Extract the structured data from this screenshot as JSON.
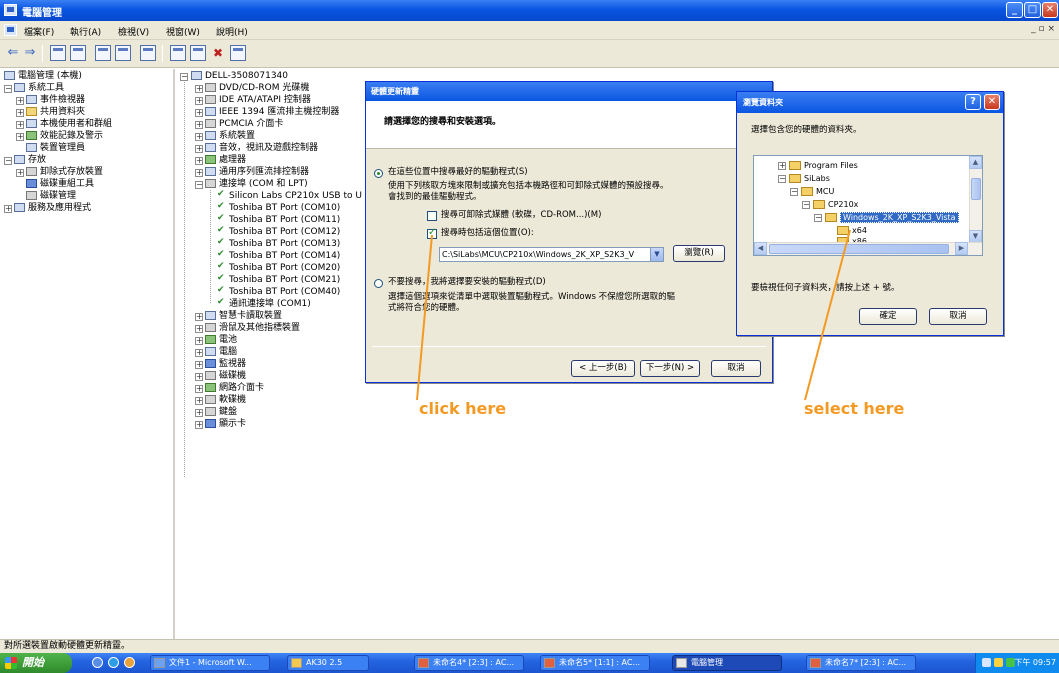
{
  "window": {
    "title": "電腦管理",
    "minimize_label": "_",
    "maximize_label": "□",
    "close_label": "✕"
  },
  "menu": {
    "items": [
      "檔案(F)",
      "執行(A)",
      "檢視(V)",
      "視窗(W)",
      "說明(H)"
    ],
    "mdi_controls": "_ ▫ ×"
  },
  "left_tree": {
    "root": "電腦管理 (本機)",
    "system_tools": "系統工具",
    "event_viewer": "事件檢視器",
    "shared_folders": "共用資料夾",
    "local_users": "本機使用者和群組",
    "perf_logs": "效能記錄及警示",
    "device_manager": "裝置管理員",
    "storage": "存放",
    "removable_storage": "卸除式存放裝置",
    "defrag": "磁碟重組工具",
    "disk_mgmt": "磁碟管理",
    "services": "服務及應用程式"
  },
  "device_tree": {
    "root": "DELL-3508071340",
    "dvd": "DVD/CD-ROM 光碟機",
    "ide": "IDE ATA/ATAPI 控制器",
    "ieee": "IEEE 1394 匯流排主機控制器",
    "pcmcia": "PCMCIA 介面卡",
    "system": "系統裝置",
    "sound": "音效，視訊及遊戲控制器",
    "processor": "處理器",
    "usb": "通用序列匯流排控制器",
    "ports": "連接埠 (COM 和 LPT)",
    "port_items": [
      "Silicon Labs CP210x USB to U",
      "Toshiba BT Port (COM10)",
      "Toshiba BT Port (COM11)",
      "Toshiba BT Port (COM12)",
      "Toshiba BT Port (COM13)",
      "Toshiba BT Port (COM14)",
      "Toshiba BT Port (COM20)",
      "Toshiba BT Port (COM21)",
      "Toshiba BT Port (COM40)",
      "通訊連接埠 (COM1)"
    ],
    "smartcard": "智慧卡讀取裝置",
    "mouse": "滑鼠及其他指標裝置",
    "battery": "電池",
    "computer": "電腦",
    "monitor": "監視器",
    "disk": "磁碟機",
    "network": "網路介面卡",
    "floppy": "軟碟機",
    "keyboard": "鍵盤",
    "display": "顯示卡"
  },
  "wizard": {
    "title": "硬體更新精靈",
    "header": "請選擇您的搜尋和安裝選項。",
    "option1": "在這些位置中搜尋最好的驅動程式(S)",
    "option1_desc_line1": "使用下列核取方塊來限制或擴充包括本機路徑和可卸除式媒體的預設搜尋。",
    "option1_desc_line2": "會找到的最佳驅動程式。",
    "check_removable": "搜尋可卸除式媒體 (軟碟，CD-ROM...)(M)",
    "check_include_path": "搜尋時包括這個位置(O):",
    "path_value": "C:\\SiLabs\\MCU\\CP210x\\Windows_2K_XP_S2K3_V",
    "browse_button": "瀏覽(R)",
    "option2": "不要搜尋，我將選擇要安裝的驅動程式(D)",
    "option2_desc_line1": "選擇這個選項來從清單中選取裝置驅動程式。Windows 不保證您所選取的驅",
    "option2_desc_line2": "式將符合您的硬體。",
    "back_button": "< 上一步(B)",
    "next_button": "下一步(N) >",
    "cancel_button": "取消"
  },
  "browse_dialog": {
    "title": "瀏覽資料夾",
    "help_label": "?",
    "close_label": "✕",
    "instruction": "選擇包含您的硬體的資料夾。",
    "folders": [
      "Program Files",
      "SiLabs",
      "MCU",
      "CP210x",
      "Windows_2K_XP_S2K3_Vista",
      "x64",
      "x86"
    ],
    "hint": "要檢視任何子資料夾，請按上述 + 號。",
    "ok_button": "確定",
    "cancel_button": "取消"
  },
  "annotations": {
    "click_here": "click here",
    "select_here": "select here",
    "color": "#f39a24"
  },
  "statusbar": {
    "text": "對所選裝置啟動硬體更新精靈。"
  },
  "taskbar": {
    "start_label": "開始",
    "tasks": [
      "文件1 - Microsoft W...",
      "AK30 2.5",
      "未命名4* [2:3] : AC...",
      "未命名5* [1:1] : AC...",
      "電腦管理",
      "未命名7* [2:3] : AC..."
    ],
    "clock": "下午 09:57"
  }
}
